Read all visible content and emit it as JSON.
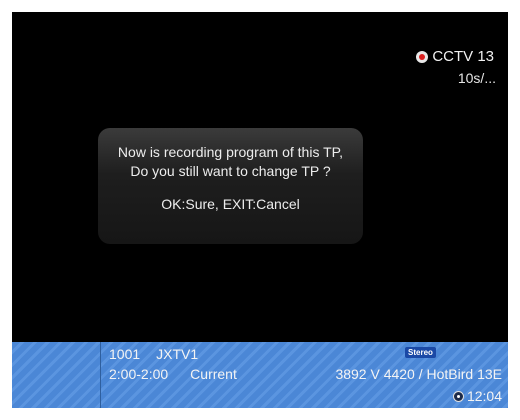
{
  "recording": {
    "channel": "CCTV 13",
    "elapsed": "10s/..."
  },
  "dialog": {
    "message": "Now is recording program of this TP, Do you still want to change TP ?",
    "options": "OK:Sure, EXIT:Cancel"
  },
  "infobar": {
    "service_number": "1001",
    "service_name": "JXTV1",
    "time_range": "2:00-2:00",
    "epg_status": "Current",
    "audio_badge": "Stereo",
    "transponder": "3892 V 4420 / HotBird 13E",
    "clock": "12:04"
  },
  "colors": {
    "infobar_blue": "#4b87d6",
    "record_red": "#d92020",
    "badge_blue": "#1a49a6"
  }
}
